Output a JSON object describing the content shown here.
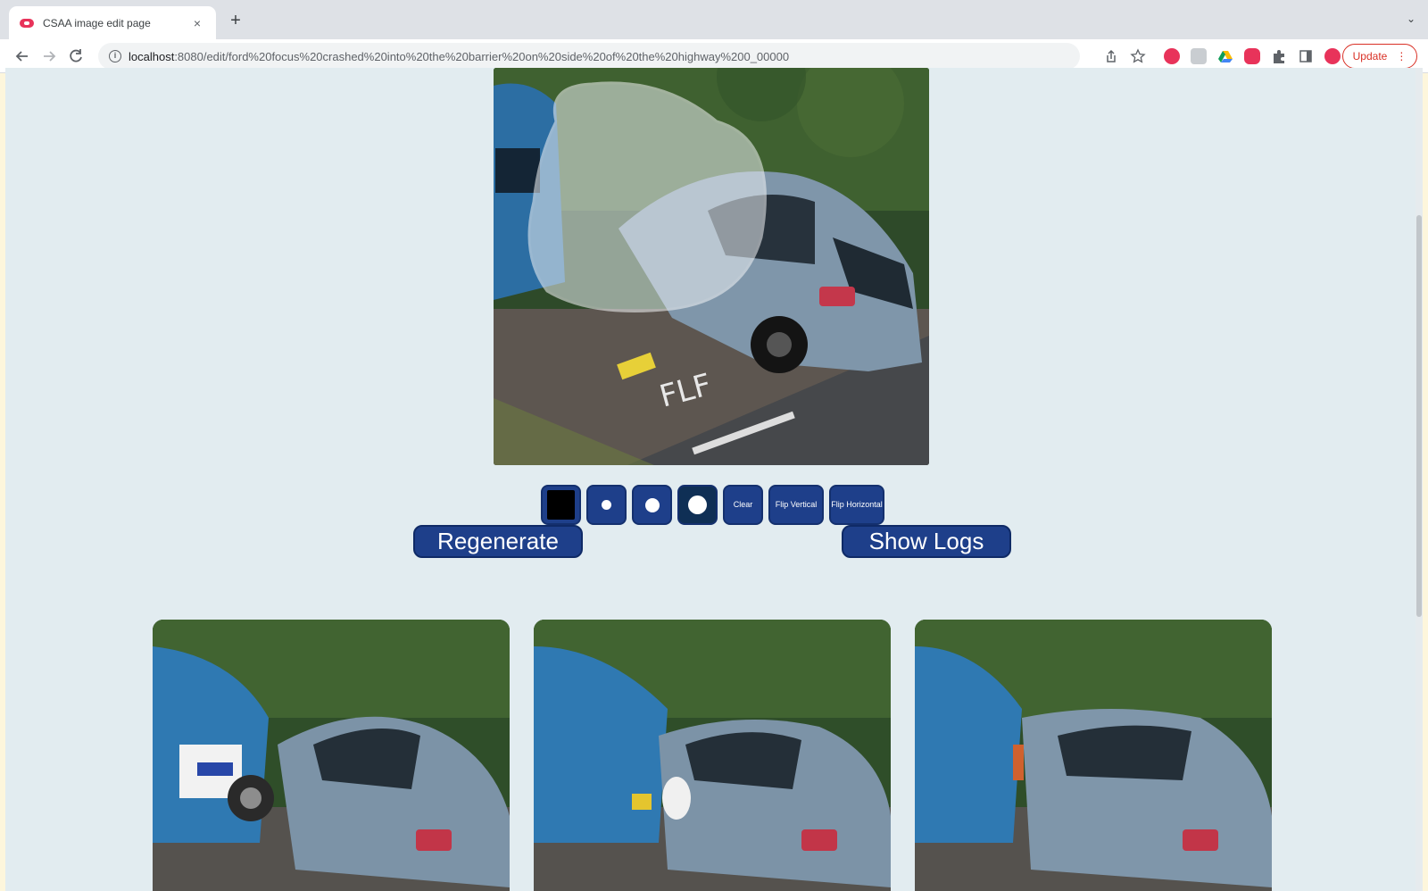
{
  "browser": {
    "tab_title": "CSAA image edit page",
    "tab_close": "×",
    "new_tab": "+",
    "tab_menu": "⌄",
    "url_host": "localhost",
    "url_rest": ":8080/edit/ford%20focus%20crashed%20into%20the%20barrier%20on%20side%20of%20the%20highway%200_00000",
    "update_label": "Update",
    "update_menu": "⋮"
  },
  "tools": {
    "clear_label": "Clear",
    "flip_vertical_label": "Flip Vertical",
    "flip_horizontal_label": "Flip Horizontal",
    "brush_color": "#000000"
  },
  "actions": {
    "regenerate_label": "Regenerate",
    "show_logs_label": "Show Logs"
  },
  "colors": {
    "page_bg": "#e2ecf0",
    "button": "#1e3f8a",
    "update_accent": "#d93025"
  }
}
